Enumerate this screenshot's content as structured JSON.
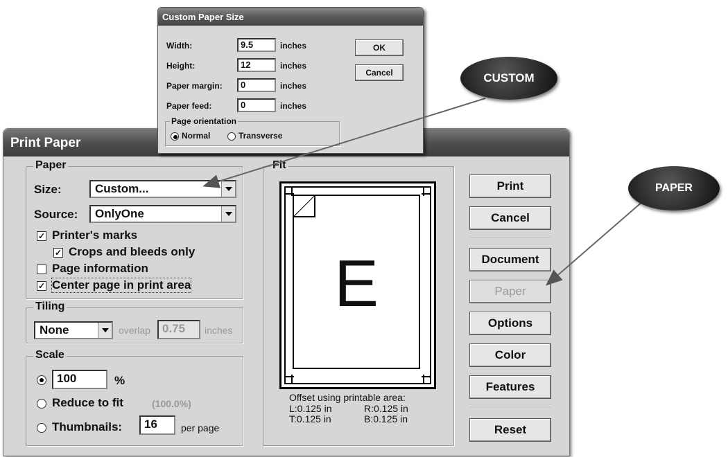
{
  "custom_dialog": {
    "title": "Custom Paper Size",
    "width_label": "Width:",
    "width_value": "9.5",
    "height_label": "Height:",
    "height_value": "12",
    "margin_label": "Paper margin:",
    "margin_value": "0",
    "feed_label": "Paper feed:",
    "feed_value": "0",
    "unit": "inches",
    "ok_label": "OK",
    "cancel_label": "Cancel",
    "orientation_group": "Page orientation",
    "normal_label": "Normal",
    "transverse_label": "Transverse",
    "orientation_selected": "Normal"
  },
  "main_dialog": {
    "title": "Print Paper",
    "paper_group": "Paper",
    "size_label": "Size:",
    "size_value": "Custom...",
    "source_label": "Source:",
    "source_value": "OnlyOne",
    "printers_marks": "Printer's marks",
    "printers_marks_checked": true,
    "crops_bleeds": "Crops and bleeds only",
    "crops_bleeds_checked": true,
    "page_information": "Page information",
    "page_information_checked": false,
    "center_page": "Center page in print area",
    "center_page_checked": true,
    "tiling_group": "Tiling",
    "tiling_value": "None",
    "overlap_label": "overlap",
    "overlap_value": "0.75",
    "overlap_unit": "inches",
    "scale_group": "Scale",
    "scale_value": "100",
    "scale_unit": "%",
    "reduce_label": "Reduce to fit",
    "reduce_value": "(100.0%)",
    "thumbnails_label": "Thumbnails:",
    "thumbnails_value": "16",
    "per_page": "per page",
    "scale_selected": "percent",
    "fit_group": "Fit",
    "preview_letter": "E",
    "offset_title": "Offset using printable area:",
    "offset_left": "L:0.125 in",
    "offset_right": "R:0.125 in",
    "offset_top": "T:0.125 in",
    "offset_bottom": "B:0.125 in",
    "buttons": {
      "print": "Print",
      "cancel": "Cancel",
      "document": "Document",
      "paper": "Paper",
      "options": "Options",
      "color": "Color",
      "features": "Features",
      "reset": "Reset"
    }
  },
  "callouts": {
    "custom": "CUSTOM",
    "paper": "PAPER"
  }
}
